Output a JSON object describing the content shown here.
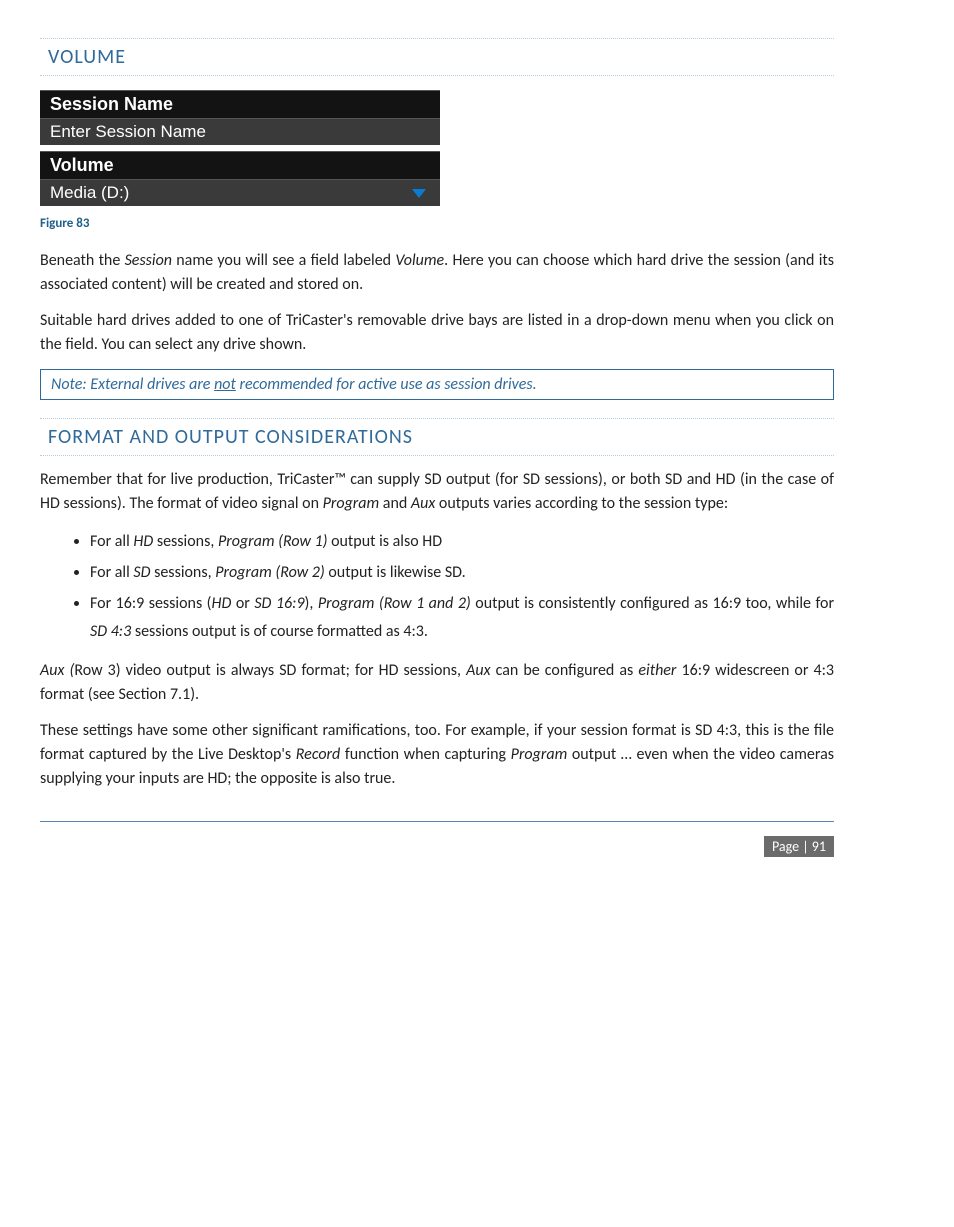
{
  "sections": {
    "volume_title": "VOLUME",
    "format_title": "FORMAT AND OUTPUT CONSIDERATIONS"
  },
  "panel": {
    "session_label": "Session Name",
    "session_value": "Enter Session Name",
    "volume_label": "Volume",
    "volume_value": "Media   (D:)"
  },
  "figure_caption": "Figure 83",
  "paragraphs": {
    "p1_a": "Beneath the ",
    "p1_b": "Session",
    "p1_c": " name you will see a field labeled ",
    "p1_d": "Volume",
    "p1_e": ".  Here you can choose which hard drive the session (and its associated content) will be created and stored on.",
    "p2": "Suitable hard drives added to one of TriCaster's removable drive bays are listed in a drop-down menu when you click on the field. You can select any drive shown.",
    "p3": "Remember that for live production, TriCaster™ can supply SD output (for SD sessions), or both SD and HD (in the case of HD sessions).  The format of video signal on ",
    "p3_prog": "Program",
    "p3_and": " and ",
    "p3_aux": "Aux",
    "p3_tail": " outputs varies according to the session type:",
    "p4_a": "Aux (",
    "p4_b": "Row 3) video output is always SD format; for HD sessions, ",
    "p4_c": "Aux",
    "p4_d": " can be configured as ",
    "p4_e": "either",
    "p4_f": " 16:9 widescreen or 4:3 format (see Section 7.1).",
    "p5_a": "These settings have some other significant ramifications, too.  For example, if your session format is SD 4:3, this is the file format captured by the Live Desktop's ",
    "p5_b": "Record",
    "p5_c": " function when capturing ",
    "p5_d": "Program",
    "p5_e": " output … even when the video cameras supplying your inputs are HD; the opposite is also true."
  },
  "note": {
    "prefix": "Note: External drives are ",
    "underline": "not",
    "suffix": " recommended for active use as session drives."
  },
  "bullets": {
    "b1_a": "For all ",
    "b1_b": "HD",
    "b1_c": " sessions, ",
    "b1_d": "Program (Row 1)",
    "b1_e": " output is also HD",
    "b2_a": "For all ",
    "b2_b": "SD",
    "b2_c": " sessions, ",
    "b2_d": "Program (Row 2)",
    "b2_e": " output is likewise SD.",
    "b3_a": "For 16:9 sessions (",
    "b3_b": "HD",
    "b3_c": " or ",
    "b3_d": "SD 16:9",
    "b3_e": "), ",
    "b3_f": "Program (Row 1 and 2)",
    "b3_g": " output is consistently configured as 16:9 too, while for ",
    "b3_h": "SD 4:3",
    "b3_i": " sessions output is of course formatted as 4:3."
  },
  "footer": {
    "page_label": "Page | 91"
  }
}
